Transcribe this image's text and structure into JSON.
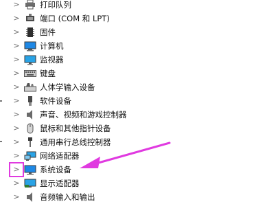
{
  "tree": {
    "items": [
      {
        "label": "打印队列",
        "icon": "printer-icon"
      },
      {
        "label": "端口 (COM 和 LPT)",
        "icon": "port-icon"
      },
      {
        "label": "固件",
        "icon": "firmware-icon"
      },
      {
        "label": "计算机",
        "icon": "computer-icon"
      },
      {
        "label": "监视器",
        "icon": "monitor-icon"
      },
      {
        "label": "键盘",
        "icon": "keyboard-icon"
      },
      {
        "label": "人体学输入设备",
        "icon": "hid-icon"
      },
      {
        "label": "软件设备",
        "icon": "software-device-icon"
      },
      {
        "label": "声音、视频和游戏控制器",
        "icon": "speaker-icon"
      },
      {
        "label": "鼠标和其他指针设备",
        "icon": "mouse-icon"
      },
      {
        "label": "通用串行总线控制器",
        "icon": "usb-icon"
      },
      {
        "label": "网络适配器",
        "icon": "network-adapter-icon"
      },
      {
        "label": "系统设备",
        "icon": "system-device-icon"
      },
      {
        "label": "显示适配器",
        "icon": "display-adapter-icon"
      },
      {
        "label": "音频输入和输出",
        "icon": "audio-io-icon"
      }
    ],
    "expand_glyph": ">"
  },
  "annotation": {
    "highlight_color": "#e03ae0",
    "highlighted_item": "系统设备"
  }
}
